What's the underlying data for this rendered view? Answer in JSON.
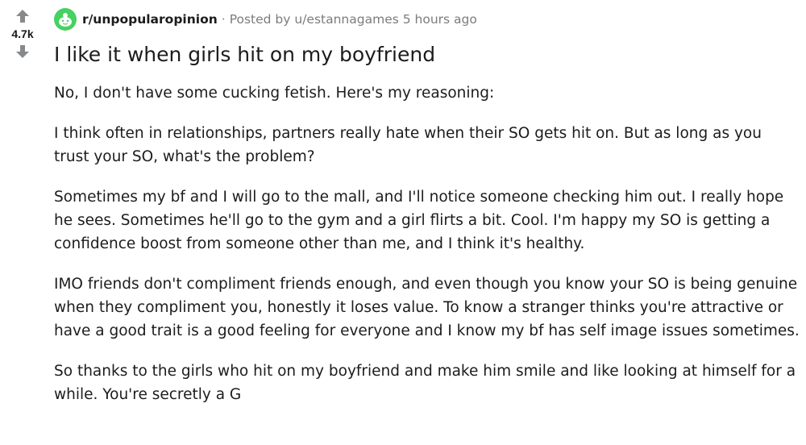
{
  "vote": {
    "count": "4.7k",
    "upvote_icon": "arrow-up-icon",
    "downvote_icon": "arrow-down-icon"
  },
  "meta": {
    "subreddit": "r/unpopularopinion",
    "separator": "·",
    "posted_by": "Posted by u/estannagames 5 hours ago",
    "subreddit_icon": "subreddit-avatar-icon",
    "accent_color": "#46d160"
  },
  "post": {
    "title": "I like it when girls hit on my boyfriend",
    "paragraphs": [
      "No, I don't have some cucking fetish. Here's my reasoning:",
      "I think often in relationships, partners really hate when their SO gets hit on. But as long as you trust your SO, what's the problem?",
      "Sometimes my bf and I will go to the mall, and I'll notice someone checking him out. I really hope he sees. Sometimes he'll go to the gym and a girl flirts a bit. Cool. I'm happy my SO is getting a confidence boost from someone other than me, and I think it's healthy.",
      "IMO friends don't compliment friends enough, and even though you know your SO is being genuine when they compliment you, honestly it loses value. To know a stranger thinks you're attractive or have a good trait is a good feeling for everyone and I know my bf has self image issues sometimes.",
      "So thanks to the girls who hit on my boyfriend and make him smile and like looking at himself for a while. You're secretly a G"
    ]
  }
}
